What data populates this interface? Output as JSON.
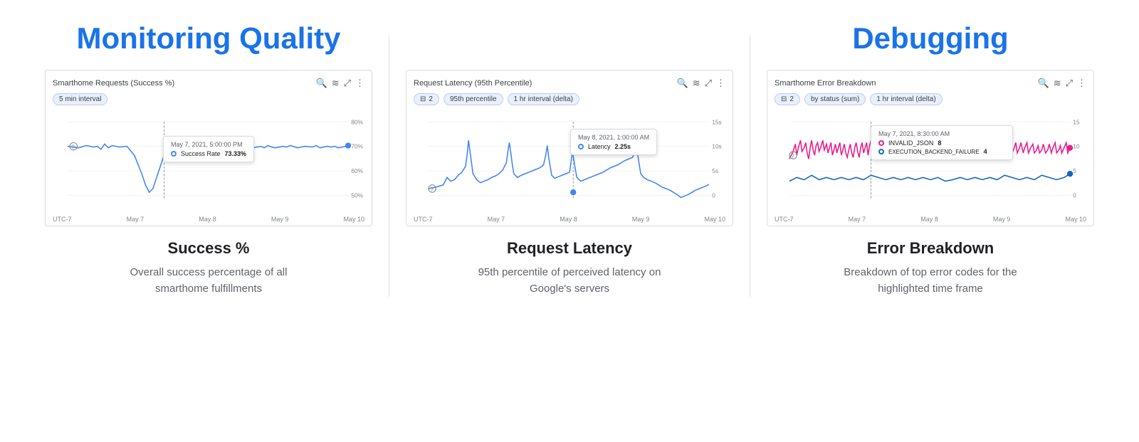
{
  "sections": [
    {
      "heading": "Monitoring Quality",
      "charts": [
        {
          "title": "Smarthome Requests (Success %)",
          "filters": [
            "5 min interval"
          ],
          "filter_icon": false,
          "y_labels": [
            "80%",
            "70%",
            "60%",
            "50%"
          ],
          "x_labels": [
            "UTC-7",
            "May 7",
            "May 8",
            "May 9",
            "May 10"
          ],
          "tooltip": {
            "date": "May 7, 2021, 5:00:00 PM",
            "series": "Success Rate",
            "value": "73.33%",
            "dot_color": "blue"
          }
        }
      ],
      "metric_title": "Success %",
      "metric_desc": "Overall success percentage of all smarthome fulfillments"
    },
    {
      "heading": null,
      "charts": [
        {
          "title": "Request Latency (95th Percentile)",
          "filters": [
            "2",
            "95th percentile",
            "1 hr interval (delta)"
          ],
          "filter_icon": true,
          "y_labels": [
            "15s",
            "10s",
            "5s",
            "0"
          ],
          "x_labels": [
            "UTC-7",
            "May 7",
            "May 8",
            "May 9",
            "May 10"
          ],
          "tooltip": {
            "date": "May 8, 2021, 1:00:00 AM",
            "series": "Latency",
            "value": "2.25s",
            "dot_color": "blue"
          }
        }
      ],
      "metric_title": "Request Latency",
      "metric_desc": "95th percentile of perceived latency on Google's servers"
    },
    {
      "heading": "Debugging",
      "charts": [
        {
          "title": "Smarthome Error Breakdown",
          "filters": [
            "2",
            "by status (sum)",
            "1 hr interval (delta)"
          ],
          "filter_icon": true,
          "y_labels": [
            "15",
            "10",
            "5",
            "0"
          ],
          "x_labels": [
            "UTC-7",
            "May 7",
            "May 8",
            "May 9",
            "May 10"
          ],
          "tooltip": {
            "date": "May 7, 2021, 8:30:00 AM",
            "rows": [
              {
                "label": "INVALID_JSON",
                "value": "8",
                "color": "pink"
              },
              {
                "label": "EXECUTION_BACKEND_FAILURE",
                "value": "4",
                "color": "blue-dark"
              }
            ]
          }
        }
      ],
      "metric_title": "Error Breakdown",
      "metric_desc": "Breakdown of top error codes for the highlighted time frame"
    }
  ],
  "icons": {
    "search": "🔍",
    "legend": "≡",
    "expand": "⤢",
    "more": "⋮",
    "filter": "⊟"
  }
}
